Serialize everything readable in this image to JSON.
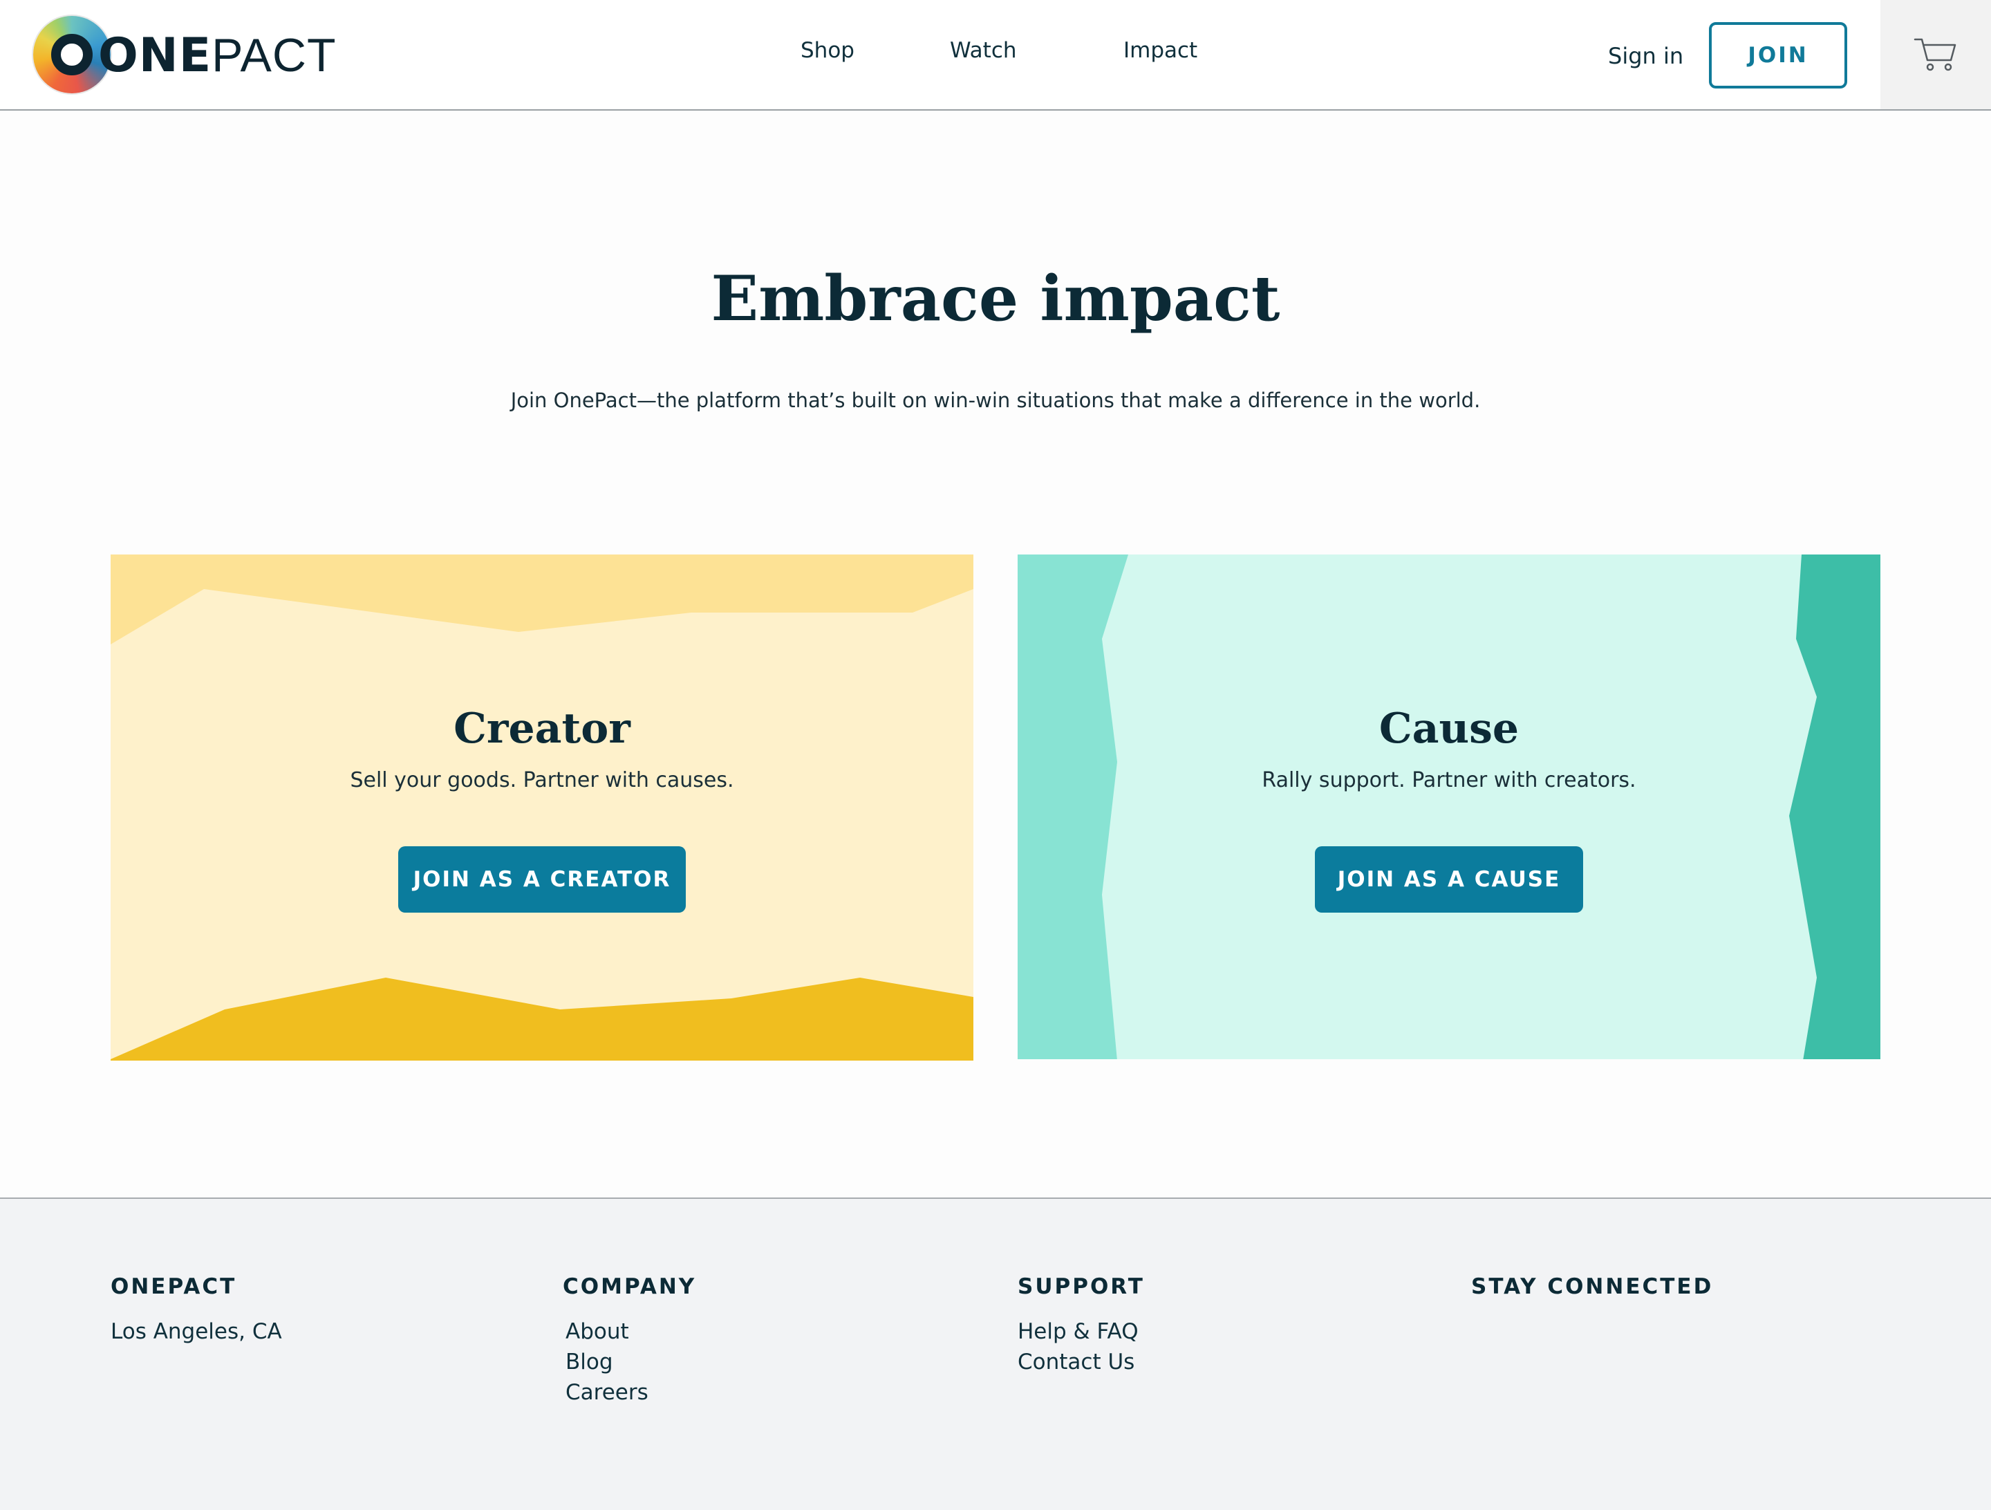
{
  "header": {
    "logo": {
      "bold": "ONE",
      "light": "PACT"
    },
    "nav": [
      {
        "label": "Shop"
      },
      {
        "label": "Watch"
      },
      {
        "label": "Impact"
      }
    ],
    "signin_label": "Sign in",
    "join_label": "JOIN",
    "cart_icon": "shopping-cart-icon"
  },
  "hero": {
    "title": "Embrace impact",
    "subtitle": "Join OnePact—the platform that’s built on win-win situations that make a difference in the world."
  },
  "cards": {
    "creator": {
      "title": "Creator",
      "subtitle": "Sell your goods. Partner with causes.",
      "button_label": "JOIN AS A CREATOR",
      "colors": {
        "bg": "#fef1cb",
        "top": "#fde295",
        "bottom": "#f0be1f"
      }
    },
    "cause": {
      "title": "Cause",
      "subtitle": "Rally support. Partner with creators.",
      "button_label": "JOIN AS A CAUSE",
      "colors": {
        "bg": "#d3f8ef",
        "left": "#88e3d3",
        "right": "#3dbea7"
      }
    }
  },
  "footer": {
    "columns": [
      {
        "heading": "ONEPACT",
        "links": [
          "Los Angeles, CA"
        ]
      },
      {
        "heading": "COMPANY",
        "links": [
          "About",
          "Blog",
          "Careers"
        ]
      },
      {
        "heading": "SUPPORT",
        "links": [
          "Help & FAQ",
          "Contact Us"
        ]
      },
      {
        "heading": "STAY CONNECTED",
        "links": []
      }
    ]
  },
  "colors": {
    "accent": "#0b7c9d",
    "text": "#0c2a36",
    "footer_bg": "#f2f3f5"
  }
}
